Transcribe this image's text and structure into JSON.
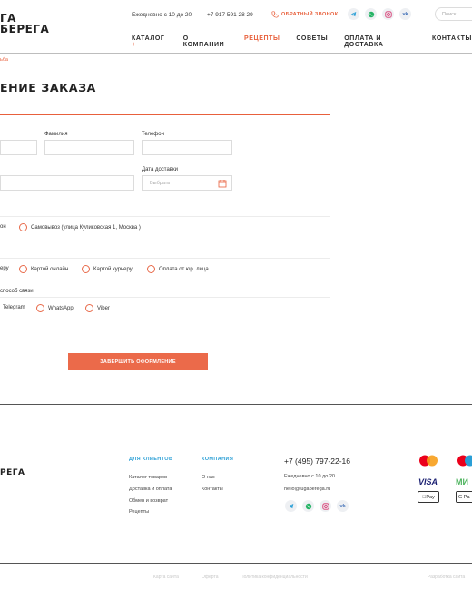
{
  "header": {
    "logo_line1": "ГА",
    "logo_line2": "БЕРЕГА",
    "hours": "Ежедневно с 10 до 20",
    "phone": "+7 917 591 28 29",
    "callback": "ОБРАТНЫЙ ЗВОНОК",
    "search_placeholder": "Поиск...",
    "nav": [
      {
        "label": "КАТАЛОГ",
        "arrow": "+"
      },
      {
        "label": "О КОМПАНИИ"
      },
      {
        "label": "РЕЦЕПТЫ"
      },
      {
        "label": "СОВЕТЫ"
      },
      {
        "label": "ОПЛАТА И ДОСТАВКА"
      },
      {
        "label": "КОНТАКТЫ"
      }
    ],
    "active_nav_color": "#e8603c"
  },
  "breadcrumb": "ьба",
  "page": {
    "title": "ЕНИЕ ЗАКАЗА",
    "fields": {
      "surname_label": "Фамилия",
      "phone_label": "Телефон",
      "date_label": "Дата доставки",
      "date_placeholder": "Выбрать"
    },
    "delivery_options": [
      "он",
      "Самовывоз (улица Куликовская 1, Москва )"
    ],
    "payment_options": [
      "еру",
      "Картой онлайн",
      "Картой курьеру",
      "Оплата от юр. лица"
    ],
    "contact_title": "способ связи",
    "contact_options": [
      "Telegram",
      "WhatsApp",
      "Viber"
    ],
    "submit_label": "ЗАВЕРШИТЬ ОФОРМЛЕНИЕ"
  },
  "footer": {
    "logo": "РЕГА",
    "col1_title": "ДЛЯ КЛИЕНТОВ",
    "col1_links": [
      "Каталог товаров",
      "Доставка и оплата",
      "Обмен и возврат",
      "Рецепты"
    ],
    "col2_title": "КОМПАНИЯ",
    "col2_links": [
      "О нас",
      "Контакты"
    ],
    "phone": "+7 (495) 797-22-16",
    "hours": "Ежедневно с 10 до 20",
    "email": "hello@lugaberega.ru",
    "bottom_links": [
      "Карта сайта",
      "Оферта",
      "Политика конфиденциальности"
    ],
    "credit": "Разработка сайта"
  },
  "colors": {
    "accent": "#e8603c",
    "footer_title": "#2a9fd6"
  },
  "icons": {
    "telegram": "telegram-icon",
    "whatsapp": "whatsapp-icon",
    "instagram": "instagram-icon",
    "vk": "vk-icon",
    "calendar": "calendar-icon",
    "phone": "phone-icon"
  }
}
